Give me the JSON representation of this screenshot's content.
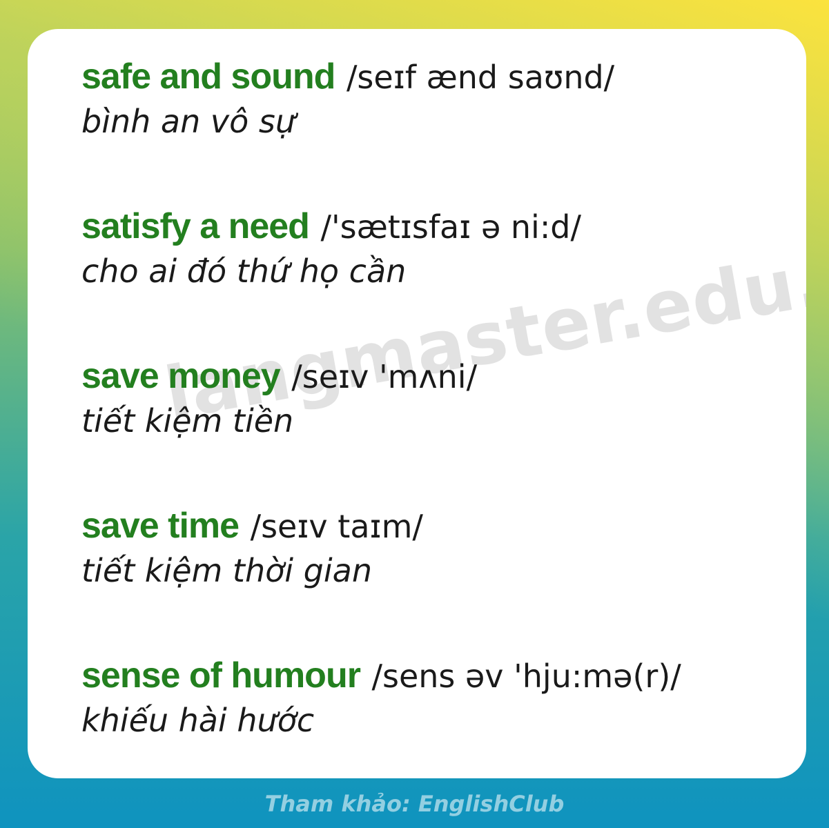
{
  "watermark": "langmaster.edu.vn",
  "entries": [
    {
      "term": "safe and sound",
      "ipa": "/seɪf ænd saʊnd/",
      "meaning": "bình an vô sự"
    },
    {
      "term": "satisfy a need",
      "ipa": "/'sætɪsfaɪ ə ni:d/",
      "meaning": "cho ai đó thứ họ cần"
    },
    {
      "term": "save money",
      "ipa": "/seɪv 'mʌni/",
      "meaning": "tiết kiệm tiền"
    },
    {
      "term": "save time",
      "ipa": "/seɪv taɪm/",
      "meaning": "tiết kiệm thời gian"
    },
    {
      "term": "sense of humour",
      "ipa": "/sens əv 'hju:mə(r)/",
      "meaning": "khiếu hài hước"
    }
  ],
  "footer": "Tham khảo: EnglishClub",
  "colors": {
    "term": "#237f1f",
    "card": "#ffffff",
    "text": "#1a1a1a"
  }
}
